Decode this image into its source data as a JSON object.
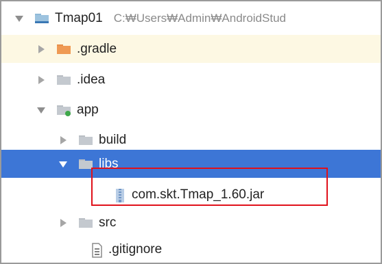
{
  "tree": {
    "root": {
      "name": "Tmap01",
      "path": "C:₩Users₩Admin₩AndroidStud"
    },
    "gradle": {
      "name": ".gradle"
    },
    "idea": {
      "name": ".idea"
    },
    "app": {
      "name": "app"
    },
    "build": {
      "name": "build"
    },
    "libs": {
      "name": "libs"
    },
    "jar": {
      "name": "com.skt.Tmap_1.60.jar"
    },
    "src": {
      "name": "src"
    },
    "gitignore": {
      "name": ".gitignore"
    }
  },
  "colors": {
    "selected_row": "#3d76d6",
    "gradle_row": "#fdf8e3",
    "highlight_box": "#e0101a",
    "folder_orange": "#e8904a",
    "folder_gray": "#c4c9cf"
  }
}
